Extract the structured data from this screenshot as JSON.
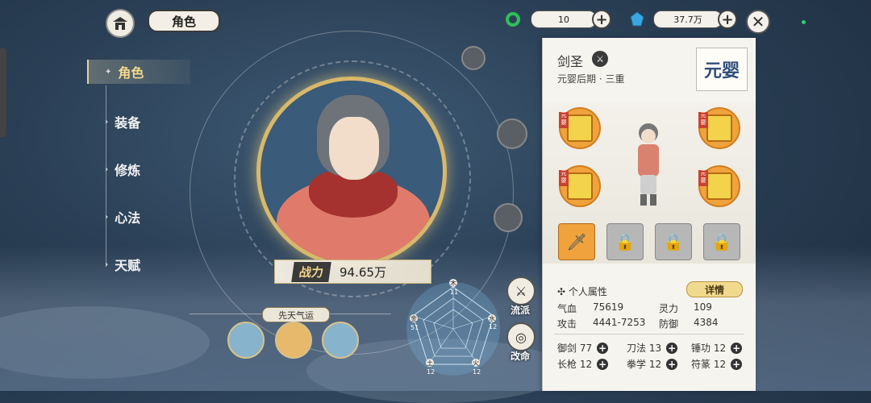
{
  "header": {
    "title": "角色",
    "currency1": {
      "icon": "jade-ring-icon",
      "value": "10"
    },
    "currency2": {
      "icon": "spirit-stone-icon",
      "value": "37.7万"
    }
  },
  "nav": {
    "items": [
      {
        "label": "角色",
        "active": true
      },
      {
        "label": "装备",
        "active": false
      },
      {
        "label": "修炼",
        "active": false
      },
      {
        "label": "心法",
        "active": false
      },
      {
        "label": "天赋",
        "active": false
      }
    ]
  },
  "hero": {
    "power_tag": "战力",
    "power_value": "94.65万",
    "fate_title": "先天气运"
  },
  "radar": {
    "labels": [
      "木",
      "水",
      "火",
      "土",
      "金"
    ],
    "values": [
      "11",
      "12",
      "12",
      "12",
      "51"
    ]
  },
  "side_buttons": {
    "school": "流派",
    "change_fate": "改命"
  },
  "panel": {
    "class_name": "剑圣",
    "realm": "元婴后期 · 三重",
    "seal_text": "元婴",
    "book_tag": "元婴",
    "attr_header": "个人属性",
    "detail_button": "详情",
    "attributes": [
      {
        "label": "气血",
        "value": "75619"
      },
      {
        "label": "灵力",
        "value": "109"
      },
      {
        "label": "攻击",
        "value": "4441-7253"
      },
      {
        "label": "防御",
        "value": "4384"
      }
    ],
    "skills": [
      {
        "label": "御剑",
        "value": "77"
      },
      {
        "label": "刀法",
        "value": "13"
      },
      {
        "label": "锤功",
        "value": "12"
      },
      {
        "label": "长枪",
        "value": "12"
      },
      {
        "label": "拳学",
        "value": "12"
      },
      {
        "label": "符篆",
        "value": "12"
      }
    ]
  },
  "colors": {
    "gold": "#d8b86a",
    "accent_orange": "#f0a23d",
    "panel_bg": "#f6f4ef"
  }
}
